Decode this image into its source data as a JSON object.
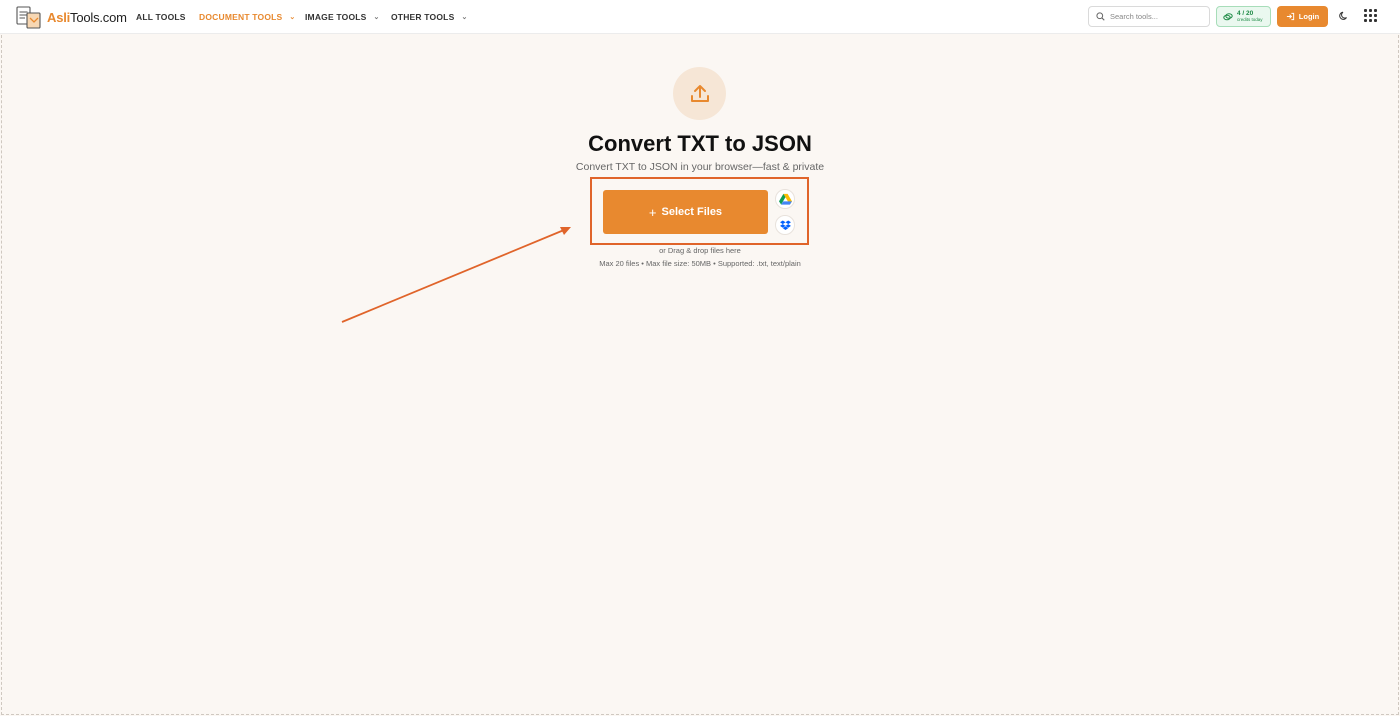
{
  "header": {
    "logo": {
      "prefix": "Asli",
      "suffix": "Tools.com"
    },
    "nav": [
      {
        "label": "ALL TOOLS",
        "has_dropdown": false,
        "active": false
      },
      {
        "label": "DOCUMENT TOOLS",
        "has_dropdown": true,
        "active": true
      },
      {
        "label": "IMAGE TOOLS",
        "has_dropdown": true,
        "active": false
      },
      {
        "label": "OTHER TOOLS",
        "has_dropdown": true,
        "active": false
      }
    ],
    "search": {
      "placeholder": "Search tools..."
    },
    "credits": {
      "count": "4 / 20",
      "label": "credits today"
    },
    "login_label": "Login"
  },
  "main": {
    "title": "Convert TXT to JSON",
    "subtitle": "Convert TXT to JSON in your browser—fast & private",
    "select_files_label": "Select Files",
    "drag_text": "or Drag & drop files here",
    "limits_text": "Max 20 files • Max file size: 50MB • Supported: .txt, text/plain"
  },
  "colors": {
    "accent": "#e8892f",
    "highlight_annotation": "#e0642a",
    "background": "#fbf7f3",
    "credits_green": "#1d8a45"
  },
  "icons": [
    "upload-icon",
    "search-icon",
    "credits-icon",
    "login-icon",
    "moon-icon",
    "apps-grid-icon",
    "google-drive-icon",
    "dropbox-icon",
    "plus-icon"
  ]
}
